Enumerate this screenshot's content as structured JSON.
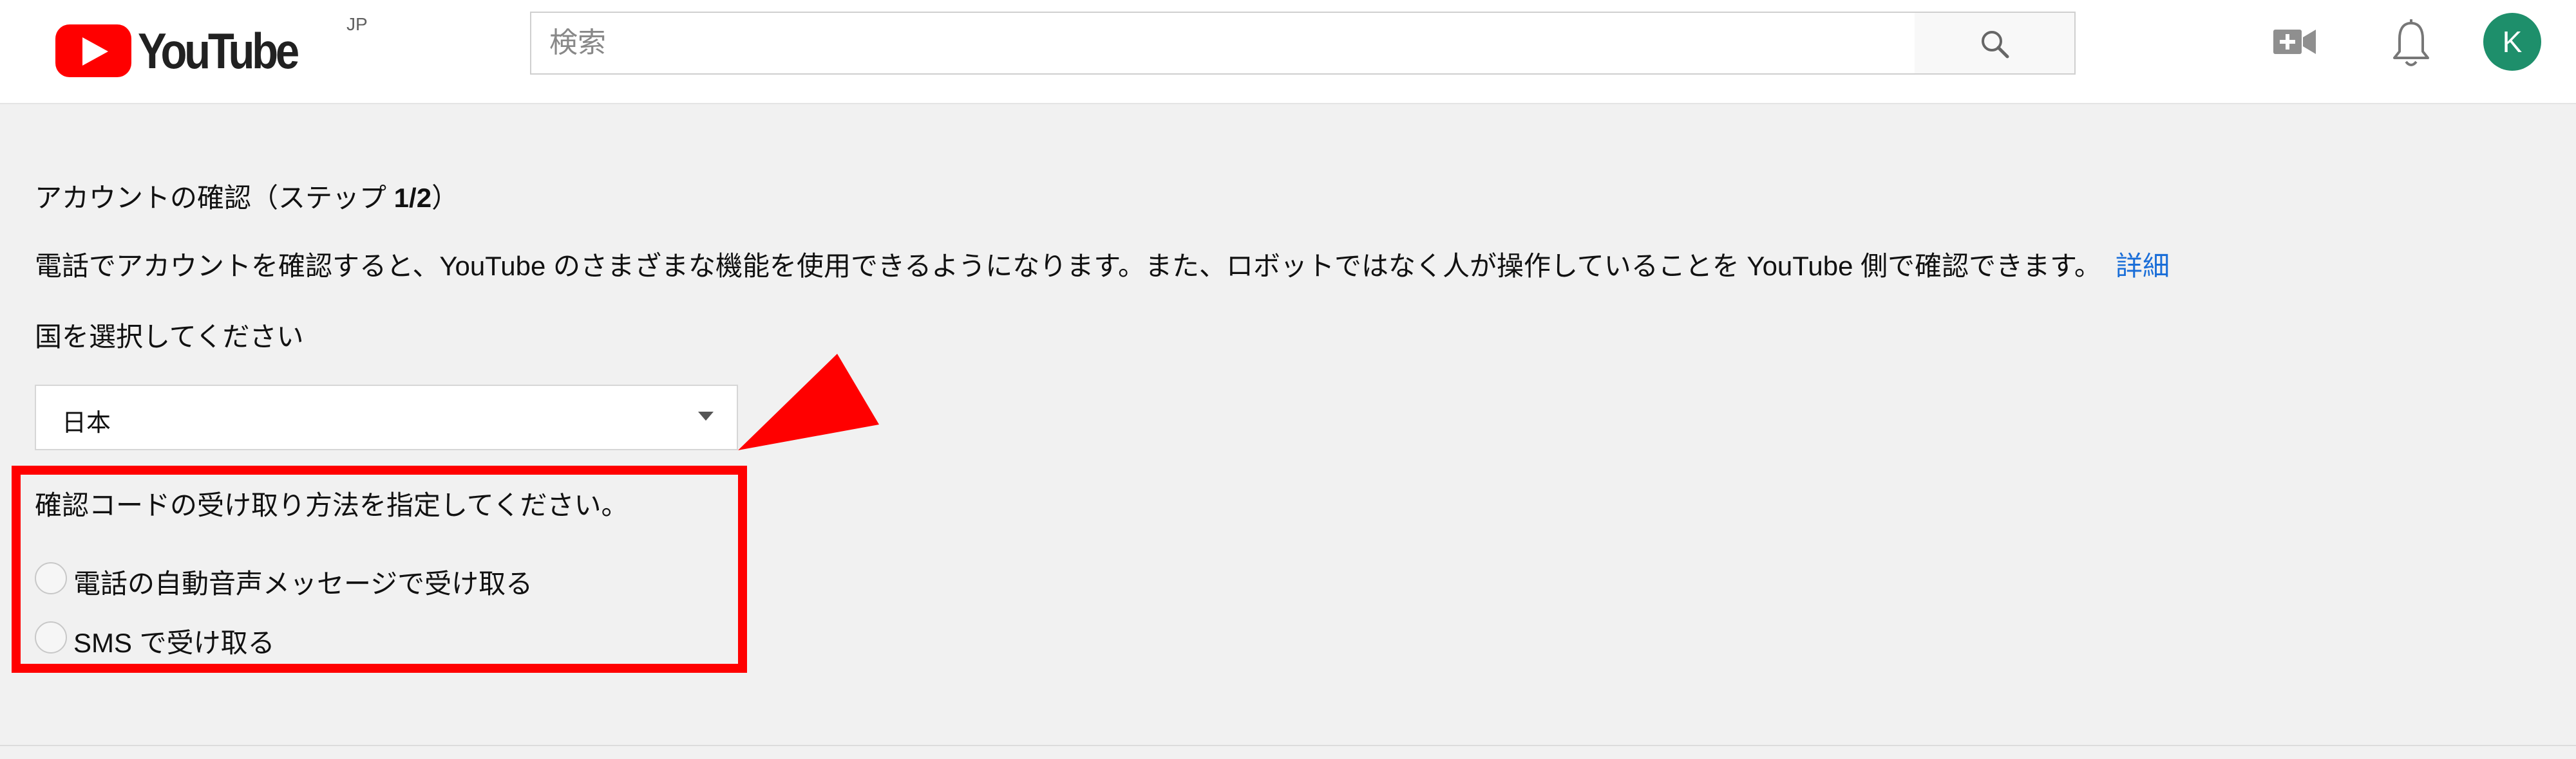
{
  "header": {
    "logo_text": "YouTube",
    "logo_region": "JP",
    "search": {
      "placeholder": "検索",
      "value": ""
    },
    "icons": [
      "search-icon",
      "create-video-icon",
      "notifications-bell-icon"
    ],
    "avatar_initial": "K",
    "avatar_color": "#1e8f6b"
  },
  "main": {
    "step_title_prefix": "アカウントの確認（ステップ ",
    "step_number": "1/2",
    "step_title_suffix": "）",
    "description": "電話でアカウントを確認すると、YouTube のさまざまな機能を使用できるようになります。また、ロボットではなく人が操作していることを YouTube 側で確認できます。",
    "details_link": "詳細",
    "country_label": "国を選択してください",
    "country_value": "日本",
    "method_label": "確認コードの受け取り方法を指定してください。",
    "methods": [
      {
        "label": "電話の自動音声メッセージで受け取る",
        "selected": false
      },
      {
        "label": "SMS で受け取る",
        "selected": false
      }
    ]
  },
  "colors": {
    "brand_red": "#ff0000",
    "link_blue": "#1a6ed8",
    "annotation_red": "#ff0000",
    "page_bg": "#f1f1f1"
  }
}
